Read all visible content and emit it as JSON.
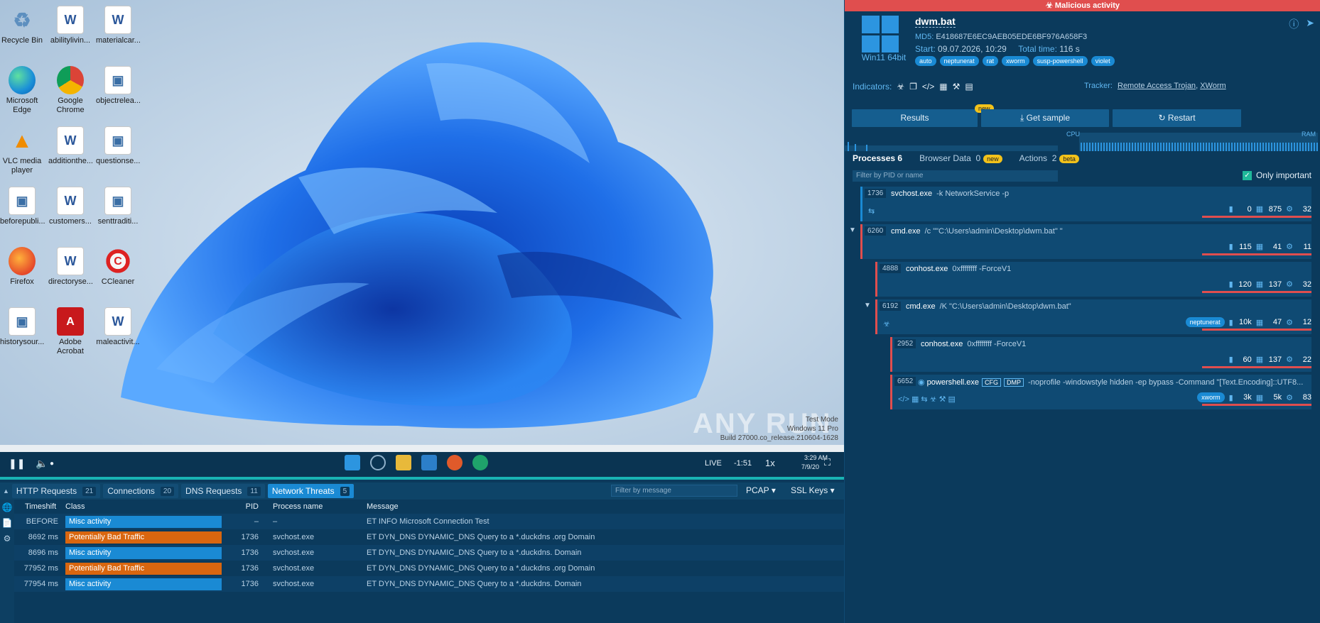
{
  "desktop": {
    "icons": [
      {
        "label": "Recycle Bin",
        "type": "bin"
      },
      {
        "label": "abilitylivin...",
        "type": "word"
      },
      {
        "label": "materialcar...",
        "type": "word"
      },
      {
        "label": "Microsoft Edge",
        "type": "edge"
      },
      {
        "label": "Google Chrome",
        "type": "chrome"
      },
      {
        "label": "objectrelea...",
        "type": "img"
      },
      {
        "label": "VLC media player",
        "type": "vlc"
      },
      {
        "label": "additionthe...",
        "type": "word"
      },
      {
        "label": "questionse...",
        "type": "img"
      },
      {
        "label": "beforepubli...",
        "type": "img"
      },
      {
        "label": "customers...",
        "type": "word"
      },
      {
        "label": "senttraditi...",
        "type": "img"
      },
      {
        "label": "Firefox",
        "type": "fox"
      },
      {
        "label": "directoryse...",
        "type": "word"
      },
      {
        "label": "CCleaner",
        "type": "cc"
      },
      {
        "label": "historysour...",
        "type": "img"
      },
      {
        "label": "Adobe Acrobat",
        "type": "acro"
      },
      {
        "label": "maleactivit...",
        "type": "word"
      }
    ],
    "watermark": "ANY RUN",
    "os_info": [
      "Test Mode",
      "Windows 11 Pro",
      "Build 27000.co_release.210604-1628"
    ]
  },
  "player": {
    "live": "LIVE",
    "time": "-1:51",
    "speed": "1x",
    "clock_time": "3:29 AM",
    "clock_date": "7/9/20"
  },
  "bottom": {
    "tabs": [
      {
        "label": "HTTP Requests",
        "count": "21"
      },
      {
        "label": "Connections",
        "count": "20"
      },
      {
        "label": "DNS Requests",
        "count": "11"
      },
      {
        "label": "Network Threats",
        "count": "5"
      }
    ],
    "filter_placeholder": "Filter by message",
    "pcap": "PCAP",
    "ssl_keys": "SSL Keys",
    "columns": {
      "time": "Timeshift",
      "class": "Class",
      "pid": "PID",
      "process": "Process name",
      "message": "Message"
    },
    "rows": [
      {
        "time": "BEFORE",
        "class": "Misc activity",
        "class_color": "#1a8ad4",
        "pid": "–",
        "process": "–",
        "message": "ET INFO Microsoft Connection Test"
      },
      {
        "time": "8692 ms",
        "class": "Potentially Bad Traffic",
        "class_color": "#d9660f",
        "pid": "1736",
        "process": "svchost.exe",
        "message": "ET DYN_DNS DYNAMIC_DNS Query to a *.duckdns .org Domain"
      },
      {
        "time": "8696 ms",
        "class": "Misc activity",
        "class_color": "#1a8ad4",
        "pid": "1736",
        "process": "svchost.exe",
        "message": "ET DYN_DNS DYNAMIC_DNS Query to a *.duckdns. Domain"
      },
      {
        "time": "77952 ms",
        "class": "Potentially Bad Traffic",
        "class_color": "#d9660f",
        "pid": "1736",
        "process": "svchost.exe",
        "message": "ET DYN_DNS DYNAMIC_DNS Query to a *.duckdns .org Domain"
      },
      {
        "time": "77954 ms",
        "class": "Misc activity",
        "class_color": "#1a8ad4",
        "pid": "1736",
        "process": "svchost.exe",
        "message": "ET DYN_DNS DYNAMIC_DNS Query to a *.duckdns. Domain"
      }
    ]
  },
  "panel": {
    "verdict": "Malicious activity",
    "os": "Win11 64bit",
    "filename": "dwm.bat",
    "md5_label": "MD5:",
    "md5": "E418687E6EC9AEB05EDE6BF976A658F3",
    "start_label": "Start:",
    "start": "09.07.2026, 10:29",
    "total_label": "Total time:",
    "total": "116 s",
    "tags": [
      "auto",
      "neptunerat",
      "rat",
      "xworm",
      "susp-powershell",
      "violet"
    ],
    "indicators_label": "Indicators:",
    "tracker_label": "Tracker:",
    "tracker_links": [
      "Remote Access Trojan",
      "XWorm"
    ],
    "buttons": {
      "results": "Results",
      "get_sample": "Get sample",
      "restart": "Restart",
      "new": "new"
    },
    "cpu": "CPU",
    "ram": "RAM",
    "tabs": {
      "processes": "Processes",
      "processes_count": "6",
      "browser": "Browser Data",
      "browser_count": "0",
      "actions": "Actions",
      "actions_count": "2",
      "new": "new",
      "beta": "beta"
    },
    "filter_placeholder": "Filter by PID or name",
    "only_important": "Only important",
    "processes": [
      {
        "pid": "1736",
        "name": "svchost.exe",
        "args": "-k NetworkService -p",
        "files": "0",
        "reg": "875",
        "mods": "32",
        "tag": ""
      },
      {
        "pid": "6260",
        "name": "cmd.exe",
        "args": "/c \"\"C:\\Users\\admin\\Desktop\\dwm.bat\" \"",
        "files": "115",
        "reg": "41",
        "mods": "11",
        "tag": ""
      },
      {
        "pid": "4888",
        "name": "conhost.exe",
        "args": "0xffffffff -ForceV1",
        "files": "120",
        "reg": "137",
        "mods": "32",
        "tag": ""
      },
      {
        "pid": "6192",
        "name": "cmd.exe",
        "args": "/K \"C:\\Users\\admin\\Desktop\\dwm.bat\"",
        "files": "10k",
        "reg": "47",
        "mods": "12",
        "tag": "neptunerat"
      },
      {
        "pid": "2952",
        "name": "conhost.exe",
        "args": "0xffffffff -ForceV1",
        "files": "60",
        "reg": "137",
        "mods": "22",
        "tag": ""
      },
      {
        "pid": "6652",
        "name": "powershell.exe",
        "args": "-noprofile -windowstyle hidden -ep bypass -Command \"[Text.Encoding]::UTF8...",
        "files": "3k",
        "reg": "5k",
        "mods": "83",
        "tag": "xworm",
        "badges": [
          "CFG",
          "DMP"
        ]
      }
    ]
  }
}
